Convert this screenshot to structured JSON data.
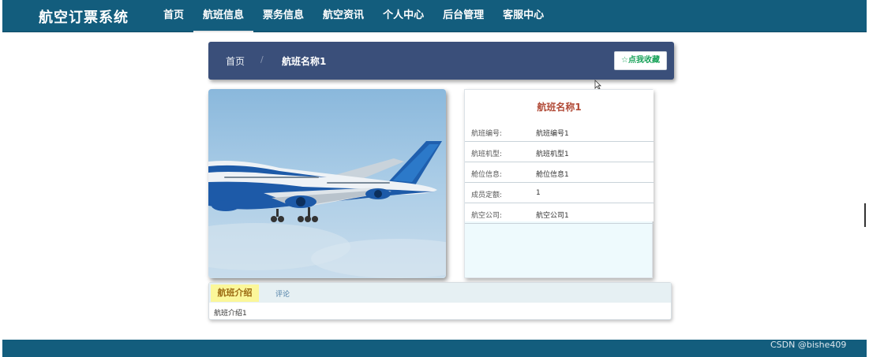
{
  "header": {
    "brand": "航空订票系统",
    "nav": [
      {
        "label": "首页"
      },
      {
        "label": "航班信息",
        "active": true
      },
      {
        "label": "票务信息"
      },
      {
        "label": "航空资讯"
      },
      {
        "label": "个人中心"
      },
      {
        "label": "后台管理"
      },
      {
        "label": "客服中心"
      }
    ]
  },
  "breadcrumb": {
    "home": "首页",
    "separator": "/",
    "current": "航班名称1",
    "favorite_label": "☆点我收藏"
  },
  "flight": {
    "title": "航班名称1",
    "fields": [
      {
        "key": "航班编号:",
        "value": "航班编号1"
      },
      {
        "key": "航班机型:",
        "value": "航班机型1"
      },
      {
        "key": "舱位信息:",
        "value": "舱位信息1"
      },
      {
        "key": "成员定额:",
        "value": "1"
      },
      {
        "key": "航空公司:",
        "value": "航空公司1"
      }
    ]
  },
  "tabs": {
    "intro_label": "航班介绍",
    "comment_label": "评论",
    "intro_content": "航班介绍1"
  },
  "footer": {
    "watermark": "CSDN @bishe409"
  },
  "colors": {
    "nav_bg": "#135d7d",
    "breadcrumb_bg": "#3a4f7a",
    "favorite_text": "#19a35a",
    "title_text": "#b14b38",
    "active_tab_bg": "#fbf79a"
  },
  "icons": {
    "favorite": "star-outline-icon",
    "cursor": "mouse-pointer-icon"
  }
}
